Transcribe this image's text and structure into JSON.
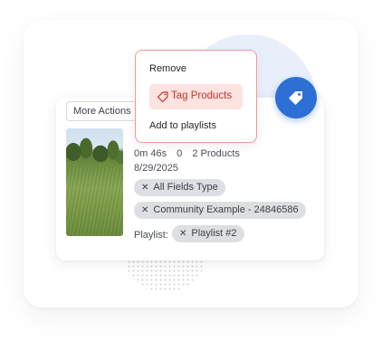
{
  "card": {
    "more_actions_label": "More Actions",
    "thumbnail_icon": "field-photo-thumbnail",
    "duration": "0m 46s",
    "count": "0",
    "products": "2 Products",
    "date": "8/29/2025",
    "tags": [
      {
        "label": "All Fields Type",
        "remove_icon": "close-icon"
      },
      {
        "label": "Community Example - 24846586",
        "remove_icon": "close-icon"
      }
    ],
    "playlist_label": "Playlist:",
    "playlist_tag": {
      "label": "Playlist #2",
      "remove_icon": "close-icon"
    }
  },
  "dropdown": {
    "items": [
      {
        "label": "Remove"
      },
      {
        "label": "Tag Products",
        "icon": "tag-icon",
        "active": true
      },
      {
        "label": "Add to playlists"
      }
    ]
  },
  "badge": {
    "icon": "tag-icon"
  },
  "colors": {
    "accent_blue": "#2e6fd6",
    "highlight_red_bg": "#fde3e0",
    "highlight_red_text": "#c2352b",
    "dropdown_border": "#ef9a93",
    "tag_bg": "#dedfe2"
  }
}
